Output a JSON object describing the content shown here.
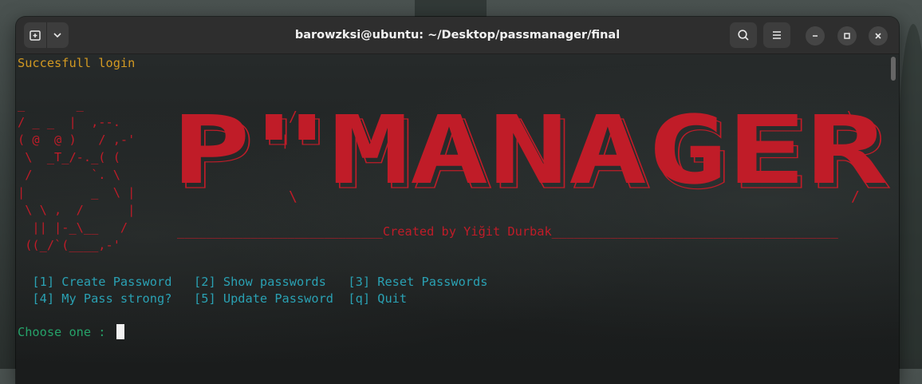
{
  "window": {
    "title": "barowzksi@ubuntu: ~/Desktop/passmanager/final"
  },
  "icons": {
    "new_tab": "new-tab-icon",
    "dropdown": "chevron-down-icon",
    "search": "search-icon",
    "menu": "hamburger-menu-icon",
    "minimize": "minimize-icon",
    "maximize": "maximize-icon",
    "close": "close-icon"
  },
  "terminal": {
    "login_status": "Succesfull login",
    "ascii_art": "_       _\n/ _ _  |  ,--.\n( @  @ )   / ,-'\n \\  _T_/-._( (\n /        `. \\\n|         _  \\ |\n \\ \\ ,  /      |\n  || |-_\\__   /\n ((_/`(____,-'",
    "banner_text": "P\"MANAGER",
    "credit_line": "____________________________Created by Yiğit Durbak_______________________________________",
    "menu_row1": "  [1] Create Password   [2] Show passwords   [3] Reset Passwords",
    "menu_row2": "  [4] My Pass strong?   [5] Update Password  [q] Quit",
    "prompt": "Choose one : "
  },
  "colors": {
    "status": "#d29922",
    "banner": "#c01c28",
    "menu": "#2aa1b3",
    "prompt": "#26a269"
  }
}
